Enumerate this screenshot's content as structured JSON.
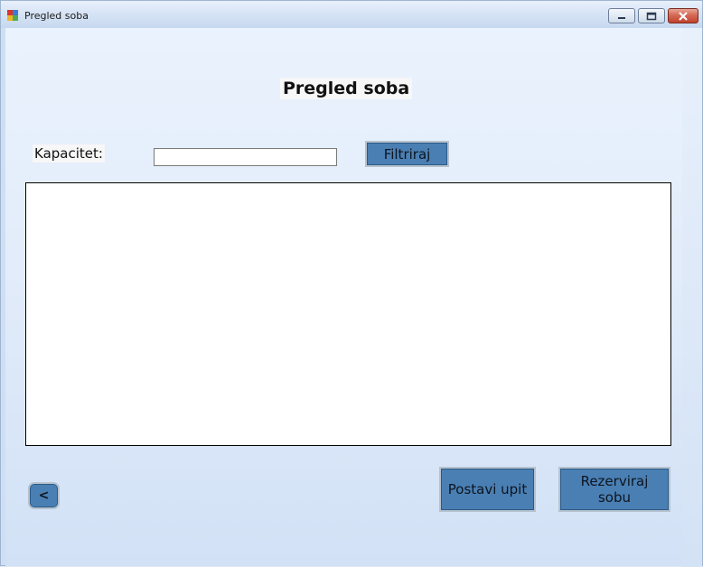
{
  "window": {
    "title": "Pregled soba",
    "controls": [
      "minimize",
      "maximize",
      "close"
    ]
  },
  "heading": "Pregled soba",
  "filter": {
    "label": "Kapacitet:",
    "value": "",
    "button_label": "Filtriraj"
  },
  "list": {
    "items": []
  },
  "footer": {
    "back_label": "<",
    "ask_label": "Postavi upit",
    "reserve_label_line1": "Rezerviraj",
    "reserve_label_line2": "sobu"
  },
  "colors": {
    "button_fill": "#4a7fb3",
    "client_bg": "#e2ecfa"
  }
}
